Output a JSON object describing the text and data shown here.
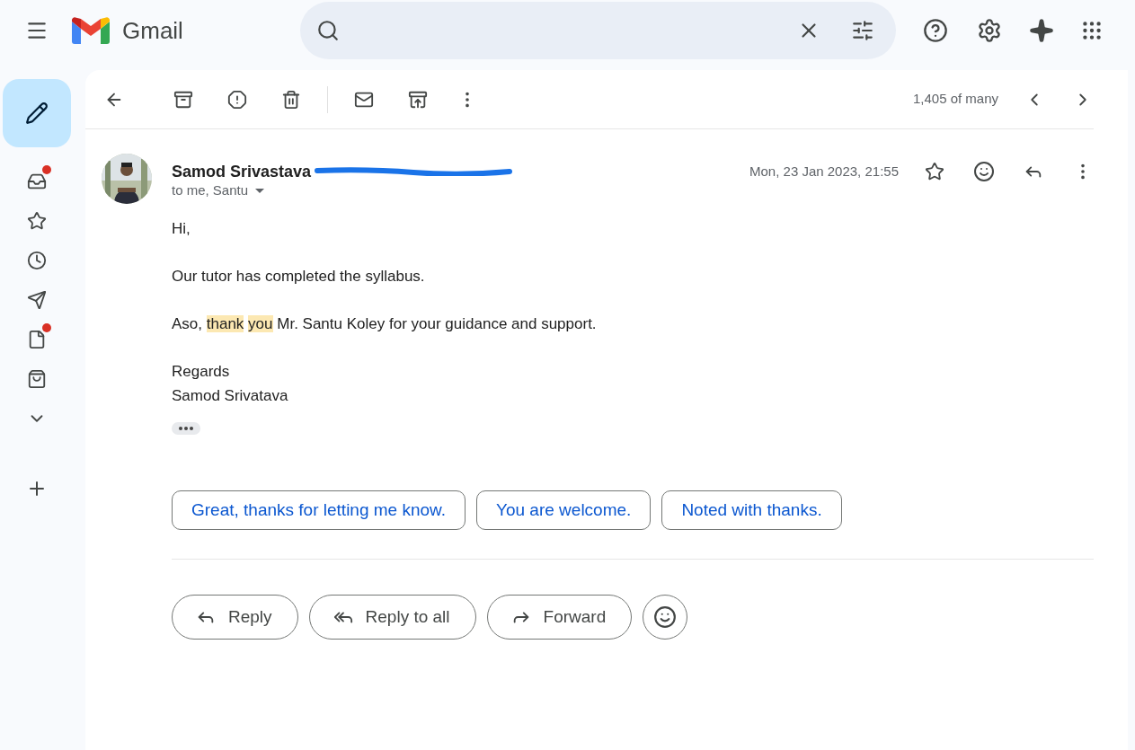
{
  "app": {
    "name": "Gmail"
  },
  "sidebar": {
    "items": [
      {
        "badge": true
      },
      {
        "badge": false
      },
      {
        "badge": false
      },
      {
        "badge": false
      },
      {
        "badge": true
      },
      {
        "badge": false
      }
    ]
  },
  "toolbar": {
    "position": "1,405 of many"
  },
  "message": {
    "sender": "Samod Srivastava",
    "recipients": "to me, Santu",
    "date": "Mon, 23 Jan 2023, 21:55",
    "paragraphs": [
      [
        {
          "text": "Hi,",
          "highlighted": false
        }
      ],
      [
        {
          "text": "Our tutor has completed the syllabus.",
          "highlighted": false
        }
      ],
      [
        {
          "text": "Aso,",
          "highlighted": false
        },
        {
          "text": "thank",
          "highlighted": true
        },
        {
          "text": "you",
          "highlighted": true
        },
        {
          "text": "Mr. Santu Koley for your guidance and support.",
          "highlighted": false
        }
      ],
      [
        {
          "text": "Regards",
          "highlighted": false
        }
      ],
      [
        {
          "text": "Samod Srivatava",
          "highlighted": false
        }
      ]
    ]
  },
  "smart_replies": [
    "Great, thanks for letting me know.",
    "You are welcome.",
    "Noted with thanks."
  ],
  "actions": [
    "Reply",
    "Reply to all",
    "Forward"
  ]
}
